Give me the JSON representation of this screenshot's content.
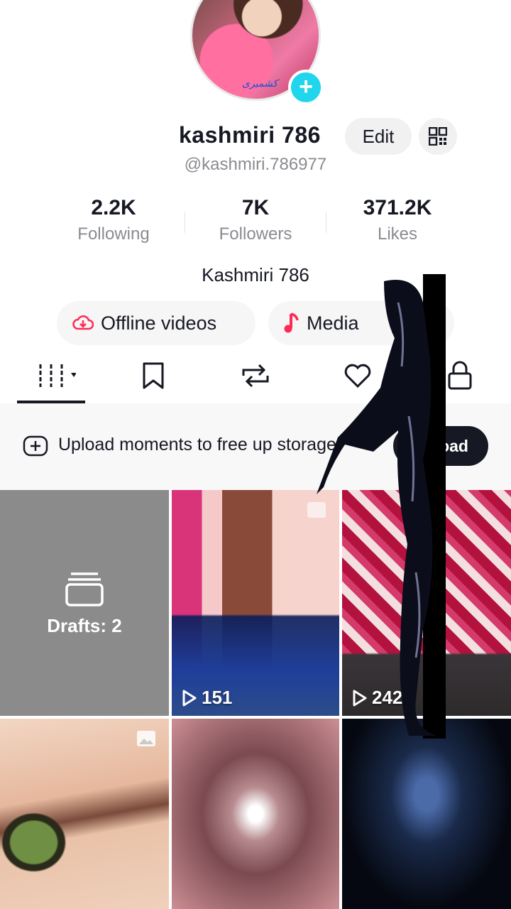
{
  "profile": {
    "avatar_caption": "کشمیری",
    "display_name": "kashmiri 786",
    "handle": "@kashmiri.786977",
    "edit_label": "Edit",
    "bio": "Kashmiri 786"
  },
  "stats": [
    {
      "value": "2.2K",
      "label": "Following"
    },
    {
      "value": "7K",
      "label": "Followers"
    },
    {
      "value": "371.2K",
      "label": "Likes"
    }
  ],
  "pills": {
    "offline": "Offline videos",
    "media": "Media"
  },
  "banner": {
    "text": "Upload moments to free up storage",
    "button": "Upload"
  },
  "drafts_label": "Drafts: 2",
  "videos": [
    {
      "views": "151"
    },
    {
      "views": "242"
    }
  ],
  "colors": {
    "accent_cyan": "#20d5ec",
    "accent_red": "#fe2c55",
    "text_primary": "#161823",
    "text_secondary": "#8a8b91"
  }
}
